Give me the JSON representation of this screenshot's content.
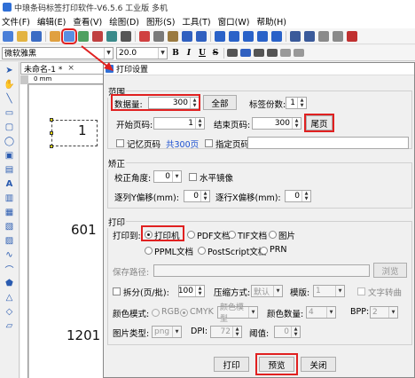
{
  "app": {
    "title": "中琅条码标签打印软件-V6.5.6 工业版 多机"
  },
  "menu": [
    "文件(F)",
    "编辑(E)",
    "查看(V)",
    "绘图(D)",
    "图形(S)",
    "工具(T)",
    "窗口(W)",
    "帮助(H)"
  ],
  "fontbar": {
    "font_name": "微软雅黑",
    "font_size": "20.0",
    "bold": "B",
    "italic": "I",
    "underline": "U",
    "strike": "S"
  },
  "document": {
    "tab_name": "未命名-1 *",
    "close": "×",
    "ruler_label": "0 mm",
    "texts": [
      "1",
      "601",
      "1201"
    ]
  },
  "dialog": {
    "title": "打印设置",
    "range": {
      "group_title": "范围",
      "quantity_label": "数据量:",
      "quantity_value": "300",
      "all_button": "全部",
      "copies_label": "标签份数:",
      "copies_value": "1",
      "start_page_label": "开始页码:",
      "start_page_value": "1",
      "end_page_label": "结束页码:",
      "end_page_value": "300",
      "last_page_button": "尾页",
      "remember_page_label": "记忆页码",
      "total_pages_text": "共300页",
      "specify_page_label": "指定页码"
    },
    "correction": {
      "group_title": "矫正",
      "angle_label": "校正角度:",
      "angle_value": "0",
      "mirror_label": "水平镜像",
      "row_y_label": "逐列Y偏移(mm):",
      "row_y_value": "0",
      "row_x_label": "逐行X偏移(mm):",
      "row_x_value": "0"
    },
    "print": {
      "group_title": "打印",
      "print_to_label": "打印到:",
      "targets": [
        "打印机",
        "PDF文档",
        "TIF文档",
        "图片",
        "PPML文档",
        "PostScript文档",
        "PRN"
      ],
      "save_path_label": "保存路径:",
      "browse_button": "浏览",
      "split_label": "拆分(页/批):",
      "split_value": "100",
      "compress_label": "压缩方式:",
      "compress_value": "默认",
      "template_label": "模版:",
      "template_value": "1",
      "text_convert_label": "文字转曲",
      "color_mode_label": "颜色模式:",
      "rgb_label": "RGB",
      "cmyk_label": "CMYK",
      "color_conv_value": "颜色模型",
      "color_count_label": "颜色数量:",
      "color_count_value": "4",
      "bpp_label": "BPP:",
      "bpp_value": "2",
      "image_type_label": "图片类型:",
      "image_type_value": "png",
      "dpi_label": "DPI:",
      "dpi_value": "72",
      "threshold_label": "阈值:",
      "threshold_value": "0"
    },
    "buttons": {
      "print": "打印",
      "preview": "预览",
      "close": "关闭"
    }
  },
  "colors": {
    "highlight": "#e02020",
    "accent_blue": "#1a4fd0"
  }
}
